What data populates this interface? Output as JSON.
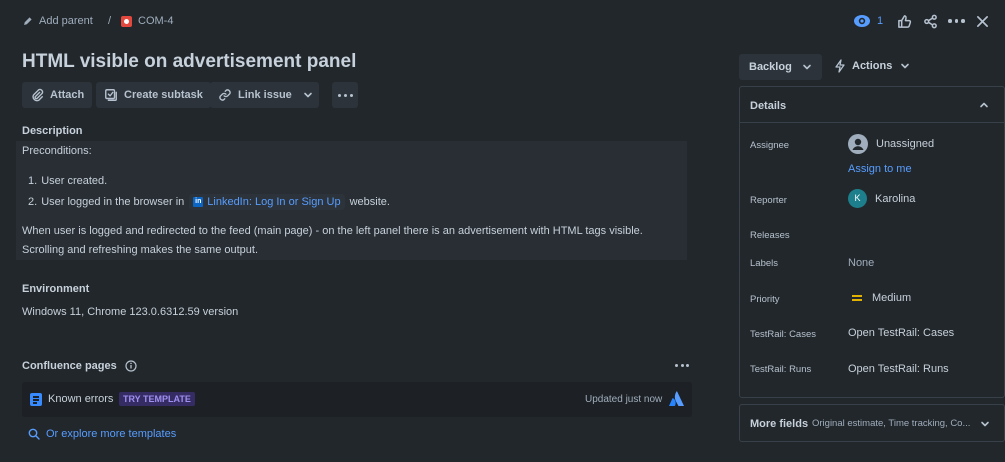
{
  "breadcrumb": {
    "add_parent": "Add parent",
    "separator": "/",
    "issue_key": "COM-4"
  },
  "top_actions": {
    "watch_count": "1"
  },
  "title": "HTML visible on advertisement panel",
  "toolbar": {
    "attach": "Attach",
    "create_subtask": "Create subtask",
    "link_issue": "Link issue"
  },
  "description": {
    "heading": "Description",
    "preconditions": "Preconditions:",
    "items": [
      {
        "num": "1.",
        "text": "User created."
      },
      {
        "num": "2.",
        "text_before": "User logged in the browser in",
        "link_badge": "in",
        "link_text": "LinkedIn: Log In or Sign Up",
        "text_after": "website."
      }
    ],
    "body_line1": "When user is logged and redirected to the feed (main page) - on the left panel there is an advertisement with HTML tags visible.",
    "body_line2": "Scrolling and refreshing makes the same output."
  },
  "environment": {
    "heading": "Environment",
    "value": "Windows 11, Chrome 123.0.6312.59 version"
  },
  "confluence": {
    "heading": "Confluence pages",
    "item_title": "Known errors",
    "item_badge": "TRY TEMPLATE",
    "item_status": "Updated just now",
    "explore": "Or explore more templates"
  },
  "side": {
    "status": "Backlog",
    "actions": "Actions",
    "details_heading": "Details",
    "assignee_label": "Assignee",
    "assignee_value": "Unassigned",
    "assign_to_me": "Assign to me",
    "reporter_label": "Reporter",
    "reporter_initial": "K",
    "reporter_value": "Karolina",
    "releases_label": "Releases",
    "labels_label": "Labels",
    "labels_value": "None",
    "priority_label": "Priority",
    "priority_value": "Medium",
    "cases_label": "TestRail: Cases",
    "cases_value": "Open TestRail: Cases",
    "runs_label": "TestRail: Runs",
    "runs_value": "Open TestRail: Runs",
    "more_fields": "More fields",
    "more_fields_sub": "Original estimate, Time tracking, Co..."
  },
  "colors": {
    "bg": "#22272b",
    "link": "#579dff",
    "priority": "#e2b203",
    "issue_red": "#e2483d",
    "badge_purple": "#9f8fef"
  }
}
